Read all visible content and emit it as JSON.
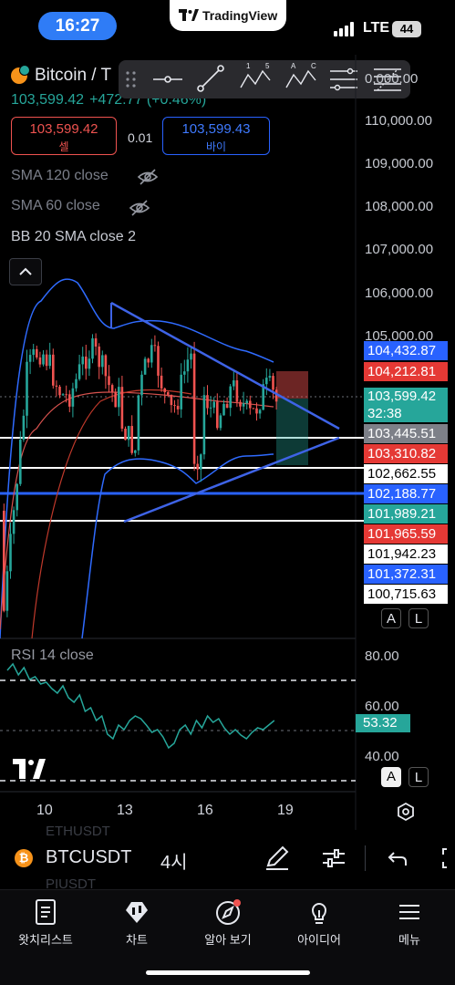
{
  "status": {
    "time": "16:27",
    "app_pill": "TradingView",
    "network": "LTE",
    "battery": "44"
  },
  "header": {
    "symbol_title": "Bitcoin / T",
    "last_price": "103,599.42",
    "change": "+472.77",
    "change_pct": "(+0.46%)",
    "sell_price": "103,599.42",
    "sell_label": "셀",
    "spread": "0.01",
    "buy_price": "103,599.43",
    "buy_label": "바이"
  },
  "indicators": {
    "sma120": "SMA 120 close",
    "sma60": "SMA 60 close",
    "bb": "BB 20 SMA close 2",
    "rsi": "RSI 14 close"
  },
  "price_scale": {
    "top_partial": "0,000.00",
    "labels": [
      "110,000.00",
      "109,000.00",
      "108,000.00",
      "107,000.00",
      "106,000.00",
      "105,000.00"
    ]
  },
  "price_tags": [
    {
      "value": "104,432.87",
      "color": "blue"
    },
    {
      "value": "104,212.81",
      "color": "red"
    },
    {
      "value": "103,599.42",
      "color": "green",
      "sub": "32:38"
    },
    {
      "value": "103,445.51",
      "color": "grey"
    },
    {
      "value": "103,310.82",
      "color": "red"
    },
    {
      "value": "102,662.55",
      "color": "white"
    },
    {
      "value": "102,188.77",
      "color": "blue"
    },
    {
      "value": "101,989.21",
      "color": "green"
    },
    {
      "value": "101,965.59",
      "color": "red"
    },
    {
      "value": "101,942.23",
      "color": "white"
    },
    {
      "value": "101,372.31",
      "color": "blue"
    },
    {
      "value": "100,715.63",
      "color": "white"
    }
  ],
  "rsi_scale": {
    "top": "80.00",
    "mid": "60.00",
    "low": "40.00",
    "value": "53.32"
  },
  "mini_buttons": {
    "auto": "A",
    "log": "L"
  },
  "x_axis": [
    "10",
    "13",
    "16",
    "19"
  ],
  "symbol_bar": {
    "ghost_top": "ETHUSDT",
    "symbol": "BTCUSDT",
    "interval": "4시",
    "ghost_bottom": "PIUSDT"
  },
  "tabs": [
    {
      "label": "왓치리스트",
      "icon": "watchlist-icon"
    },
    {
      "label": "차트",
      "icon": "chart-icon"
    },
    {
      "label": "알아 보기",
      "icon": "explore-icon"
    },
    {
      "label": "아이디어",
      "icon": "ideas-icon"
    },
    {
      "label": "메뉴",
      "icon": "menu-icon"
    }
  ],
  "colors": {
    "up": "#26a69a",
    "down": "#ef5350",
    "accent_blue": "#2962ff",
    "status_pill": "#2f7cf6"
  }
}
